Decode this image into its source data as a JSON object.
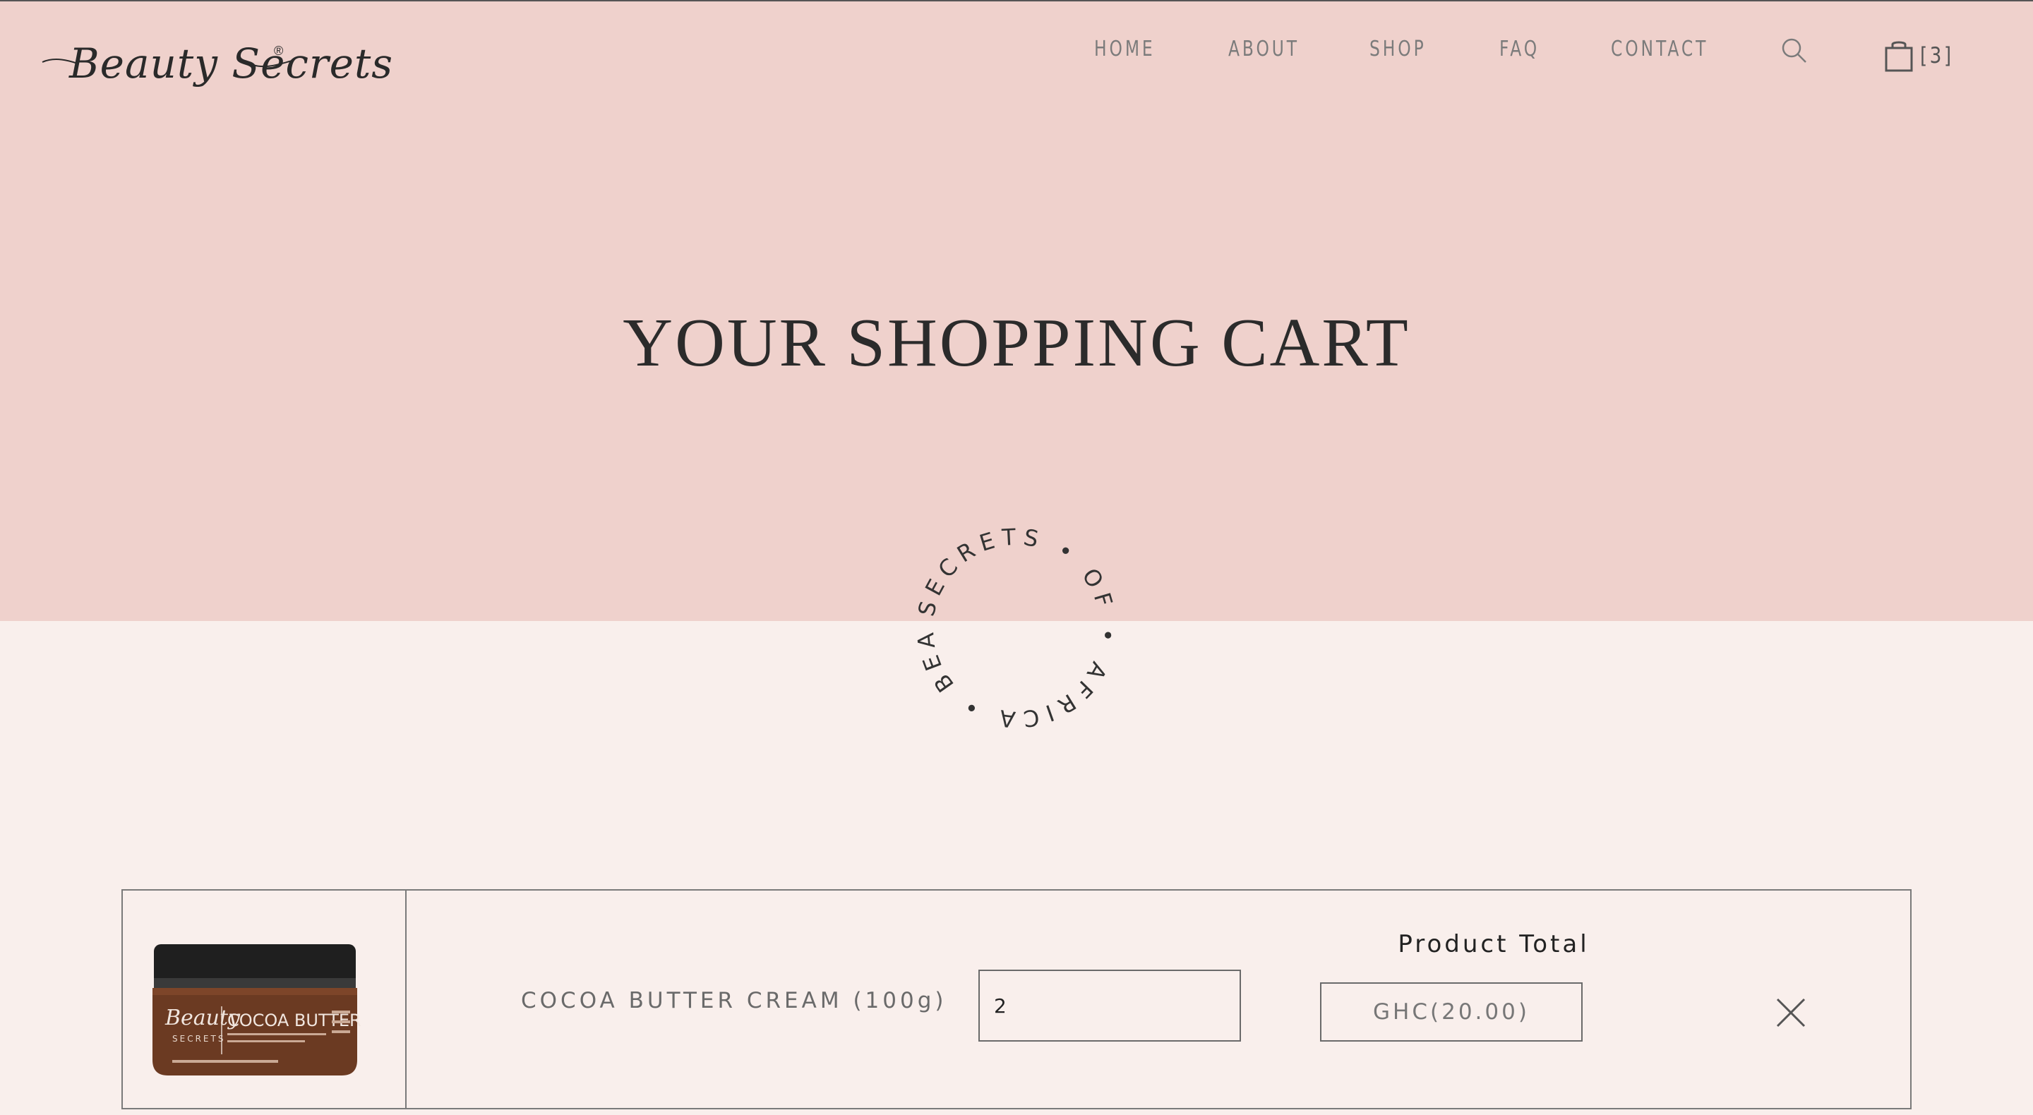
{
  "brand": {
    "logo_text": "Beauty Secrets",
    "registered_mark": "®"
  },
  "nav": {
    "items": [
      {
        "label": "HOME"
      },
      {
        "label": "ABOUT"
      },
      {
        "label": "SHOP"
      },
      {
        "label": "FAQ"
      },
      {
        "label": "CONTACT"
      }
    ]
  },
  "header": {
    "cart_count": "[3]",
    "search_icon": "search-icon",
    "cart_icon": "shopping-bag-icon"
  },
  "page": {
    "title": "YOUR SHOPPING CART"
  },
  "badge": {
    "text": "SECRETS • OF • AFRICA • BEAUTY •"
  },
  "cart": {
    "items": [
      {
        "name": "COCOA BUTTER CREAM (100g)",
        "quantity": "2",
        "total_label": "Product Total",
        "total": "GHC(20.00)",
        "image_brand": "Beauty",
        "image_subbrand": "SECRETS",
        "image_label": "COCOA BUTTER"
      }
    ]
  },
  "colors": {
    "hero_background": "#efd1cc",
    "page_background": "#f9efec",
    "text_dark": "#2b2b2b",
    "nav_text": "#7b7b7b"
  }
}
